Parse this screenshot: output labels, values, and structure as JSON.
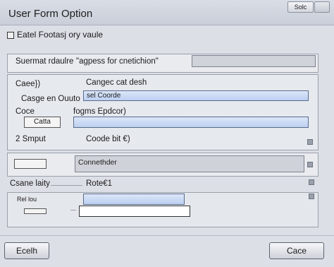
{
  "window": {
    "title": "User Form Option",
    "title_button_label": "Solc"
  },
  "header": {
    "label": "Eatel Footasj ory vaule"
  },
  "section1": {
    "label": "Suermat rdaulre",
    "description": "\"agpess for cnetichion\""
  },
  "form": {
    "row1_label": "Caee})",
    "row1_right_label": "Cangec cat desh",
    "row2_label": "Casge en Ouuto",
    "row2_field_value": "sel Coorde",
    "row3_label": "Coce",
    "row3_right_label": "fogms Epdcor)",
    "small_box_value": "Catta",
    "row4_label": "2 Smput",
    "row4_right_label": "Coode bit €)"
  },
  "section2": {
    "field_value": "Connethder"
  },
  "section3": {
    "label": "Csane laity",
    "right_label": "Rote€1",
    "sub_label": "Rel lou"
  },
  "footer": {
    "left_button": "Ecelh",
    "right_button": "Cace"
  }
}
